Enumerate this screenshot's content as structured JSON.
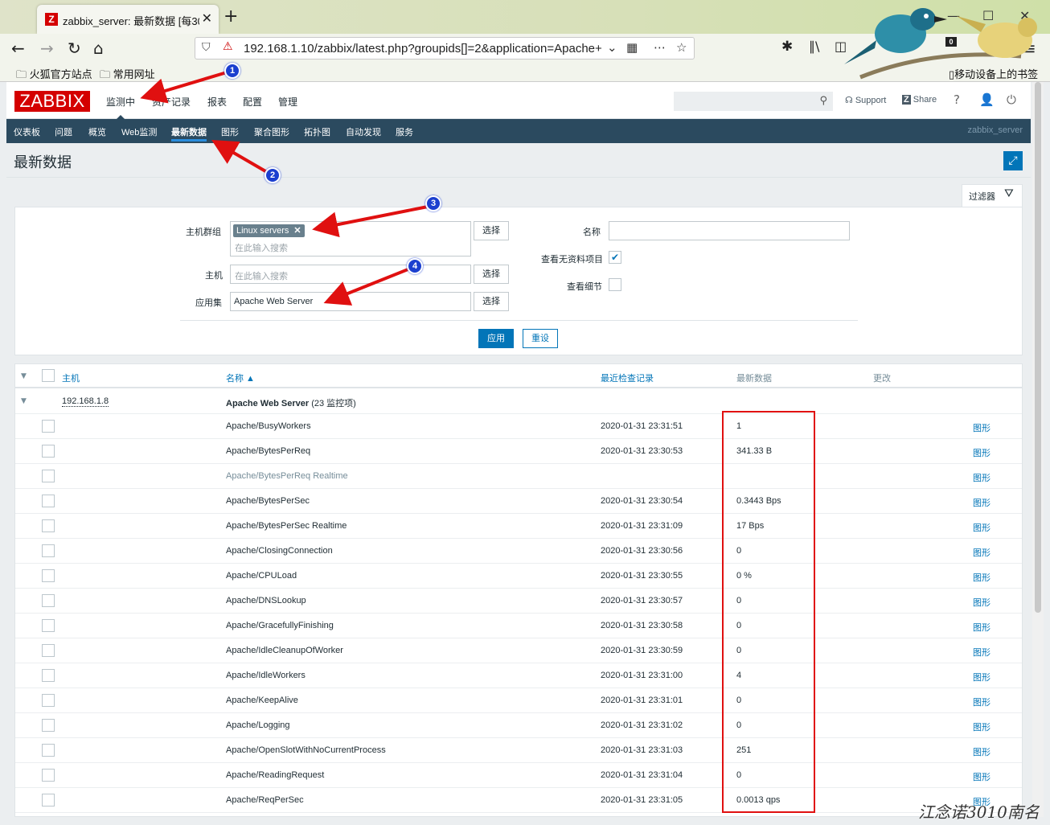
{
  "browser": {
    "tab_title": "zabbix_server: 最新数据 [每30",
    "tab_favicon": "Z",
    "url": "192.168.1.10/zabbix/latest.php?groupids[]=2&application=Apache+",
    "bookmarks": [
      "火狐官方站点",
      "常用网址"
    ],
    "mobile_bookmarks": "移动设备上的书签",
    "ext_badge": "0"
  },
  "zabbix": {
    "logo": "ZABBIX",
    "top_menu": [
      "监测中",
      "资产记录",
      "报表",
      "配置",
      "管理"
    ],
    "support": "Support",
    "share": "Share",
    "help_icon": "?",
    "sub_menu": [
      "仪表板",
      "问题",
      "概览",
      "Web监测",
      "最新数据",
      "图形",
      "聚合图形",
      "拓扑图",
      "自动发现",
      "服务"
    ],
    "server_name": "zabbix_server",
    "page_title": "最新数据"
  },
  "filter": {
    "tab_label": "过滤器",
    "host_group_label": "主机群组",
    "host_group_tag": "Linux servers",
    "search_placeholder": "在此输入搜索",
    "host_label": "主机",
    "app_label": "应用集",
    "app_value": "Apache Web Server",
    "select_label": "选择",
    "name_label": "名称",
    "show_no_data_label": "查看无资料项目",
    "show_details_label": "查看细节",
    "apply_label": "应用",
    "reset_label": "重设"
  },
  "table": {
    "headers": {
      "host": "主机",
      "name": "名称 ▲",
      "last_check": "最近检查记录",
      "last_value": "最新数据",
      "change": "更改"
    },
    "group_host": "192.168.1.8",
    "group_app": "Apache Web Server",
    "group_count": "(23 监控项)",
    "graph_label": "图形",
    "rows": [
      {
        "name": "Apache/BusyWorkers",
        "time": "2020-01-31 23:31:51",
        "value": "1"
      },
      {
        "name": "Apache/BytesPerReq",
        "time": "2020-01-31 23:30:53",
        "value": "341.33 B"
      },
      {
        "name": "Apache/BytesPerReq Realtime",
        "time": "",
        "value": ""
      },
      {
        "name": "Apache/BytesPerSec",
        "time": "2020-01-31 23:30:54",
        "value": "0.3443 Bps"
      },
      {
        "name": "Apache/BytesPerSec Realtime",
        "time": "2020-01-31 23:31:09",
        "value": "17 Bps"
      },
      {
        "name": "Apache/ClosingConnection",
        "time": "2020-01-31 23:30:56",
        "value": "0"
      },
      {
        "name": "Apache/CPULoad",
        "time": "2020-01-31 23:30:55",
        "value": "0 %"
      },
      {
        "name": "Apache/DNSLookup",
        "time": "2020-01-31 23:30:57",
        "value": "0"
      },
      {
        "name": "Apache/GracefullyFinishing",
        "time": "2020-01-31 23:30:58",
        "value": "0"
      },
      {
        "name": "Apache/IdleCleanupOfWorker",
        "time": "2020-01-31 23:30:59",
        "value": "0"
      },
      {
        "name": "Apache/IdleWorkers",
        "time": "2020-01-31 23:31:00",
        "value": "4"
      },
      {
        "name": "Apache/KeepAlive",
        "time": "2020-01-31 23:31:01",
        "value": "0"
      },
      {
        "name": "Apache/Logging",
        "time": "2020-01-31 23:31:02",
        "value": "0"
      },
      {
        "name": "Apache/OpenSlotWithNoCurrentProcess",
        "time": "2020-01-31 23:31:03",
        "value": "251"
      },
      {
        "name": "Apache/ReadingRequest",
        "time": "2020-01-31 23:31:04",
        "value": "0"
      },
      {
        "name": "Apache/ReqPerSec",
        "time": "2020-01-31 23:31:05",
        "value": "0.0013 qps"
      }
    ]
  },
  "annotations": {
    "badges": [
      "1",
      "2",
      "3",
      "4"
    ],
    "watermark": "江念诺3010南名"
  },
  "colors": {
    "zabbix_red": "#d40000",
    "nav_blue": "#2b4a5f",
    "link_blue": "#0275b8",
    "annotation_red": "#e01010",
    "badge_blue": "#1b3fcf"
  }
}
